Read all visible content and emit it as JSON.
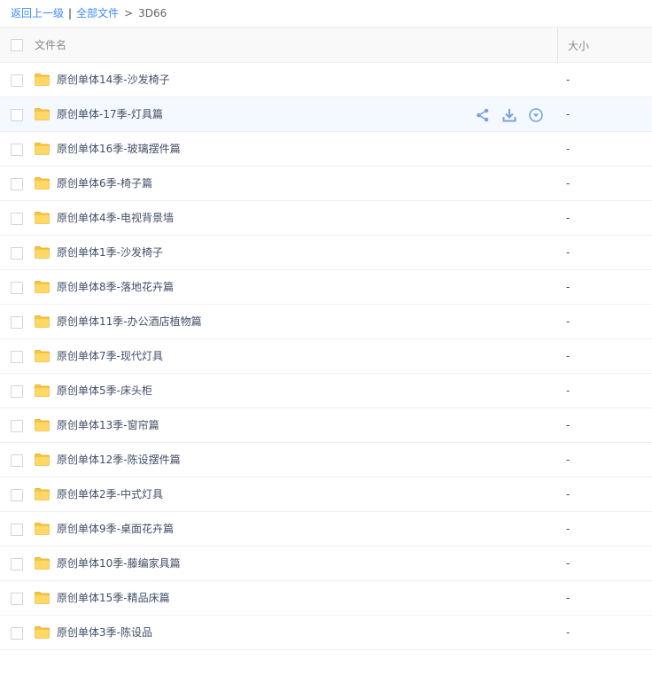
{
  "breadcrumb": {
    "back_label": "返回上一级",
    "separator": "|",
    "all_files_label": "全部文件",
    "arrow": ">",
    "current": "3D66"
  },
  "header": {
    "name_column": "文件名",
    "size_column": "大小"
  },
  "hover_row_index": 1,
  "icons": {
    "folder": "folder-icon",
    "share": "share-icon",
    "download": "download-icon",
    "more": "chevron-down-circle-icon"
  },
  "colors": {
    "link": "#3b8cff",
    "hover_row": "#f4f8ff",
    "folder": "#f9c53f"
  },
  "files": [
    {
      "name": "原创单体14季-沙发椅子",
      "size": "-"
    },
    {
      "name": "原创单体-17季-灯具篇",
      "size": "-"
    },
    {
      "name": "原创单体16季-玻璃摆件篇",
      "size": "-"
    },
    {
      "name": "原创单体6季-椅子篇",
      "size": "-"
    },
    {
      "name": "原创单体4季-电视背景墙",
      "size": "-"
    },
    {
      "name": "原创单体1季-沙发椅子",
      "size": "-"
    },
    {
      "name": "原创单体8季-落地花卉篇",
      "size": "-"
    },
    {
      "name": "原创单体11季-办公酒店植物篇",
      "size": "-"
    },
    {
      "name": "原创单体7季-现代灯具",
      "size": "-"
    },
    {
      "name": "原创单体5季-床头柜",
      "size": "-"
    },
    {
      "name": "原创单体13季-窗帘篇",
      "size": "-"
    },
    {
      "name": "原创单体12季-陈设摆件篇",
      "size": "-"
    },
    {
      "name": "原创单体2季-中式灯具",
      "size": "-"
    },
    {
      "name": "原创单体9季-桌面花卉篇",
      "size": "-"
    },
    {
      "name": "原创单体10季-藤编家具篇",
      "size": "-"
    },
    {
      "name": "原创单体15季-精品床篇",
      "size": "-"
    },
    {
      "name": "原创单体3季-陈设品",
      "size": "-"
    }
  ]
}
